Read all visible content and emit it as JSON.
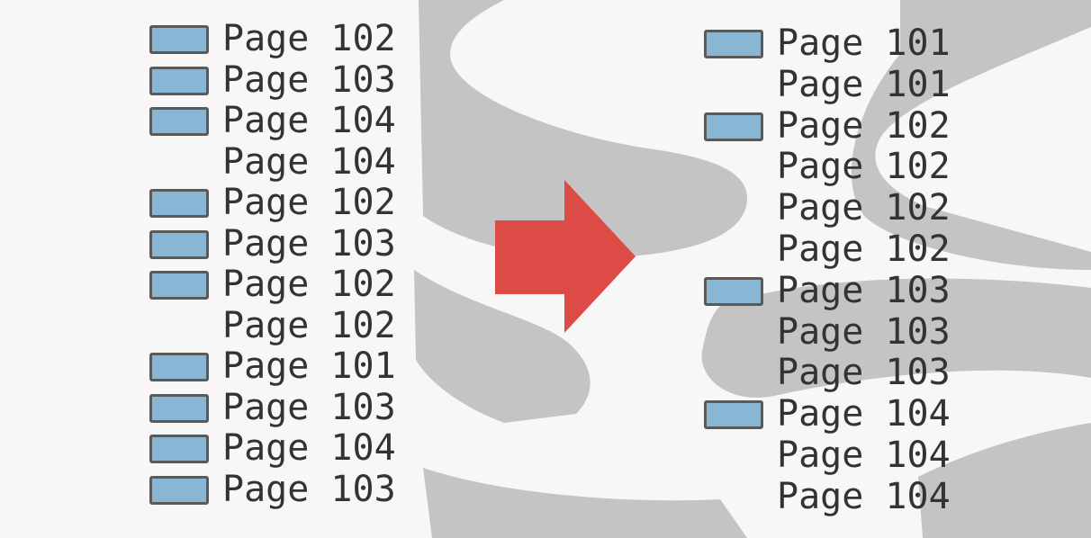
{
  "colors": {
    "background": "#f7f7f7",
    "logo": "#c4c4c4",
    "marker_fill": "#8ab6d6",
    "marker_border": "#5a5a5a",
    "arrow": "#dd4b47",
    "text": "#333333"
  },
  "left_list": [
    {
      "label": "Page 102",
      "marked": true
    },
    {
      "label": "Page 103",
      "marked": true
    },
    {
      "label": "Page 104",
      "marked": true
    },
    {
      "label": "Page 104",
      "marked": false
    },
    {
      "label": "Page 102",
      "marked": true
    },
    {
      "label": "Page 103",
      "marked": true
    },
    {
      "label": "Page 102",
      "marked": true
    },
    {
      "label": "Page 102",
      "marked": false
    },
    {
      "label": "Page 101",
      "marked": true
    },
    {
      "label": "Page 103",
      "marked": true
    },
    {
      "label": "Page 104",
      "marked": true
    },
    {
      "label": "Page 103",
      "marked": true
    }
  ],
  "right_list": [
    {
      "label": "Page 101",
      "marked": true
    },
    {
      "label": "Page 101",
      "marked": false
    },
    {
      "label": "Page 102",
      "marked": true
    },
    {
      "label": "Page 102",
      "marked": false
    },
    {
      "label": "Page 102",
      "marked": false
    },
    {
      "label": "Page 102",
      "marked": false
    },
    {
      "label": "Page 103",
      "marked": true
    },
    {
      "label": "Page 103",
      "marked": false
    },
    {
      "label": "Page 103",
      "marked": false
    },
    {
      "label": "Page 104",
      "marked": true
    },
    {
      "label": "Page 104",
      "marked": false
    },
    {
      "label": "Page 104",
      "marked": false
    }
  ],
  "arrow_icon": "right-arrow-icon",
  "background_icon": "database-logo-icon"
}
